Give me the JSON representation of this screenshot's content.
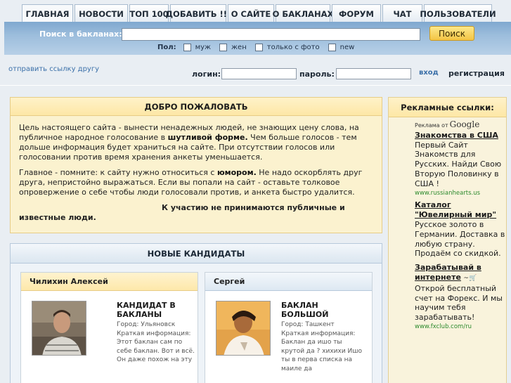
{
  "nav": {
    "tabs": [
      {
        "label": "ГЛАВНАЯ",
        "active": true
      },
      {
        "label": "НОВОСТИ"
      },
      {
        "label": "ТОП 100"
      },
      {
        "label": "ДОБАВИТЬ !!!"
      },
      {
        "label": "О САЙТЕ"
      },
      {
        "label": "О БАКЛАНАХ"
      },
      {
        "label": "ФОРУМ"
      },
      {
        "label": "ЧАТ"
      },
      {
        "label": "ПОЛЬЗОВАТЕЛИ"
      }
    ]
  },
  "search": {
    "label": "Поиск в бакланах:",
    "value": "",
    "button": "Поиск",
    "filter_label": "Пол:",
    "filters": [
      "муж",
      "жен",
      "только с фото",
      "new"
    ]
  },
  "send_link": "отправить ссылку другу",
  "login": {
    "login_label": "логин:",
    "password_label": "пароль:",
    "enter": "вход",
    "register": "регистрация"
  },
  "welcome": {
    "title": "ДОБРО ПОЖАЛОВАТЬ",
    "p1_a": "Цель настоящего сайта - вынести ненадежных людей, не знающих цену слова, на публичное народное голосование в ",
    "p1_b": "шутливой форме.",
    "p1_c": " Чем больше голосов - тем дольше информация будет храниться на сайте. При отсутствии голосов или голосовании против время хранения анкеты уменьшается.",
    "p2_a": "Главное - помните: к сайту нужно относиться с ",
    "p2_b": "юмором.",
    "p2_c": " Не надо оскорблять друг друга, непристойно выражаться. Если вы попали на сайт - оставьте толковое опровержение о себе чтобы люди голосовали против, и анкета быстро удалится.",
    "p3": "К участию не принимаются публичные и известные люди."
  },
  "candidates": {
    "title": "НОВЫЕ КАНДИДАТЫ",
    "items": [
      {
        "name": "Чилихин Алексей",
        "heading": "КАНДИДАТ В БАКЛАНЫ",
        "city": "Город: Ульяновск",
        "info": "Краткая информация: Этот баклан сам по себе баклан. Вот и всё. Он даже похож на эту"
      },
      {
        "name": "Сергей",
        "heading": "БАКЛАН БОЛЬШОЙ",
        "city": "Город: Ташкент",
        "info": "Краткая информация: Баклан да ишо ты крутой да ? хихихи Ишо ты в перва списка на маиле да"
      }
    ]
  },
  "ads": {
    "title": "Рекламные ссылки:",
    "badge": "Реклама от",
    "badge_brand": "Google",
    "items": [
      {
        "title": "Знакомства в США",
        "text": "Первый Сайт Знакомств для Русских. Найди Свою Вторую Половинку в США !",
        "url": "www.russianhearts.us"
      },
      {
        "title": "Каталог \"Ювелирный мир\"",
        "text": "Русское золото в Германии. Доставка в любую страну. Продаём со скидкой.",
        "url": ""
      },
      {
        "title": "Зарабатывай в интернете",
        "text": "Открой бесплатный счет на Форекс. И мы научим тебя зарабатывать!",
        "url": "www.fxclub.com/ru"
      }
    ]
  }
}
